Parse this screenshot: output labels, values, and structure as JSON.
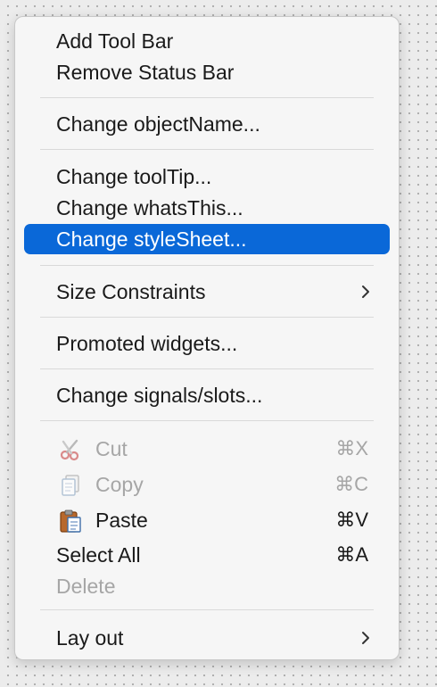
{
  "menu": {
    "items": {
      "add_tool_bar": "Add Tool Bar",
      "remove_status_bar": "Remove Status Bar",
      "change_object_name": "Change objectName...",
      "change_tool_tip": "Change toolTip...",
      "change_whats_this": "Change whatsThis...",
      "change_style_sheet": "Change styleSheet...",
      "size_constraints": "Size Constraints",
      "promoted_widgets": "Promoted widgets...",
      "change_signals_slots": "Change signals/slots...",
      "cut": "Cut",
      "copy": "Copy",
      "paste": "Paste",
      "select_all": "Select All",
      "delete": "Delete",
      "lay_out": "Lay out"
    },
    "shortcuts": {
      "cut": "⌘X",
      "copy": "⌘C",
      "paste": "⌘V",
      "select_all": "⌘A"
    },
    "highlighted_item": "Change styleSheet...",
    "disabled_items": [
      "Cut",
      "Copy",
      "Delete"
    ],
    "icons": {
      "cut": "scissors-icon",
      "copy": "copy-icon",
      "paste": "paste-icon",
      "submenu": "chevron-right-icon"
    },
    "colors": {
      "highlight": "#0a68d8",
      "text": "#1a1a1a",
      "disabled_text": "#a6a6a6"
    }
  }
}
